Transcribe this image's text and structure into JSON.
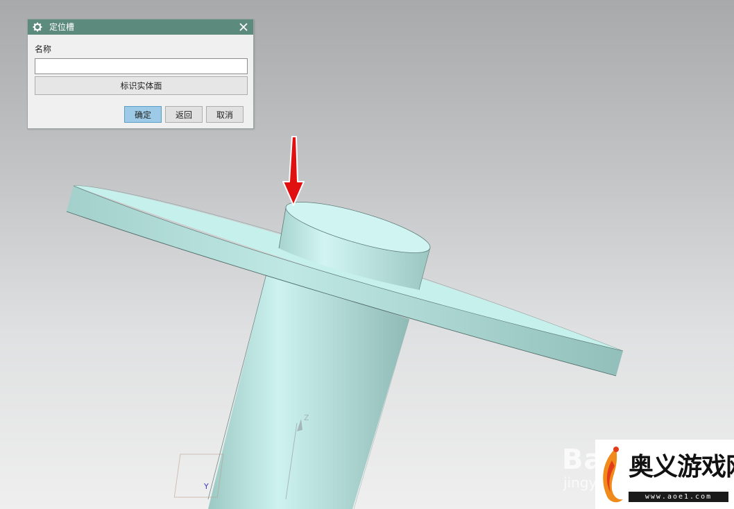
{
  "dialog": {
    "title": "定位槽",
    "name_label": "名称",
    "name_value": "",
    "identify_face_label": "标识实体面",
    "ok_label": "确定",
    "back_label": "返回",
    "cancel_label": "取消"
  },
  "watermark": {
    "baidu": "Bai",
    "jingyan": "jingy",
    "site_name": "奥义游戏网",
    "site_url": "www.aoe1.com"
  },
  "axis": {
    "z_label": "Z",
    "y_label": "Y"
  },
  "colors": {
    "titlebar": "#5c8a7c",
    "model": "#b9e6e1",
    "arrow": "#e01010",
    "primary_button": "#9dcbe7"
  }
}
